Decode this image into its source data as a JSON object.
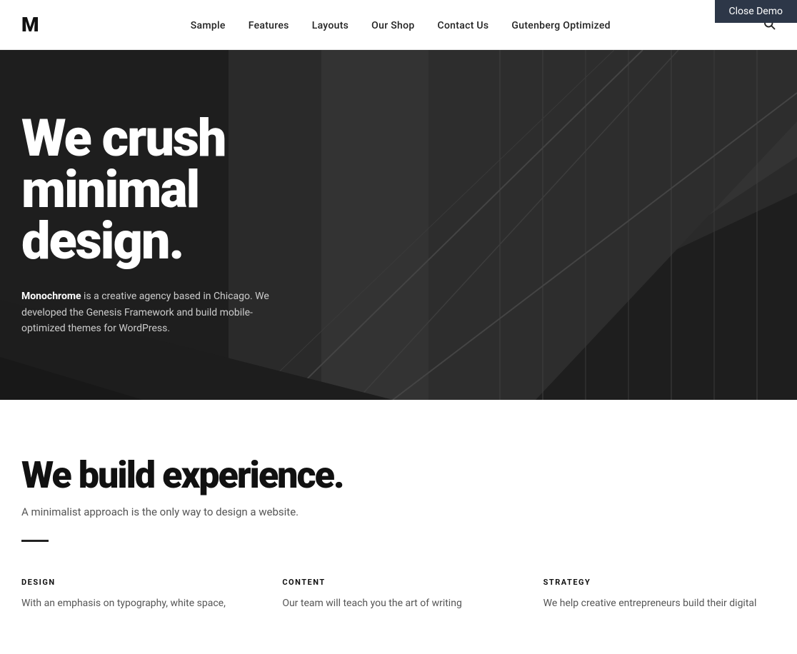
{
  "demo_bar": {
    "label": "Close Demo"
  },
  "header": {
    "logo": "M",
    "nav_items": [
      {
        "label": "Sample",
        "href": "#"
      },
      {
        "label": "Features",
        "href": "#"
      },
      {
        "label": "Layouts",
        "href": "#"
      },
      {
        "label": "Our Shop",
        "href": "#"
      },
      {
        "label": "Contact Us",
        "href": "#"
      },
      {
        "label": "Gutenberg Optimized",
        "href": "#"
      }
    ]
  },
  "hero": {
    "title": "We crush minimal design.",
    "description_bold": "Monochrome",
    "description_rest": " is a creative agency based in Chicago. We developed the Genesis Framework and build mobile-optimized themes for WordPress."
  },
  "main": {
    "section_title": "We build experience.",
    "section_subtitle": "A minimalist approach is the only way to design a website.",
    "columns": [
      {
        "label": "DESIGN",
        "text": "With an emphasis on typography, white space,"
      },
      {
        "label": "CONTENT",
        "text": "Our team will teach you the art of writing"
      },
      {
        "label": "STRATEGY",
        "text": "We help creative entrepreneurs build their digital"
      }
    ]
  }
}
